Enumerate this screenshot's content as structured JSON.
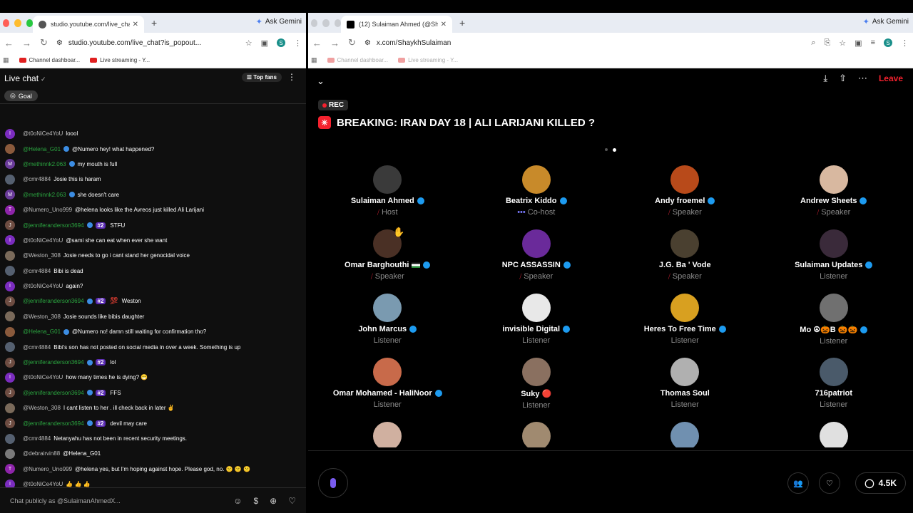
{
  "left_window": {
    "tab_title": "studio.youtube.com/live_chat",
    "url": "studio.youtube.com/live_chat?is_popout...",
    "ask_gemini": "Ask Gemini",
    "profile_initial": "S",
    "bookmarks": [
      "Channel dashboar...",
      "Live streaming - Y..."
    ]
  },
  "chat": {
    "title": "Live chat",
    "top_fans": "Top fans",
    "goal": "Goal",
    "input_placeholder": "Chat publicly as @SulaimanAhmedX...",
    "messages": [
      {
        "initial": "I",
        "color": "#7b2cbf",
        "author": "@t0oNiCe4YoU",
        "green": false,
        "verified": false,
        "rank": "",
        "prefix": "",
        "text": "loool"
      },
      {
        "initial": "",
        "color": "#8a5a3c",
        "author": "@Helena_G01",
        "green": true,
        "verified": true,
        "rank": "",
        "prefix": "",
        "text": "@Numero hey! what happened?"
      },
      {
        "initial": "M",
        "color": "#6a3b9a",
        "author": "@methinnk2.063",
        "green": true,
        "verified": true,
        "rank": "",
        "prefix": "",
        "text": "my mouth is full"
      },
      {
        "initial": "",
        "color": "#556070",
        "author": "@cmr4884",
        "green": false,
        "verified": false,
        "rank": "",
        "prefix": "",
        "text": "Josie this is haram"
      },
      {
        "initial": "M",
        "color": "#6a3b9a",
        "author": "@methinnk2.063",
        "green": true,
        "verified": true,
        "rank": "",
        "prefix": "",
        "text": "she doesn't care"
      },
      {
        "initial": "T",
        "color": "#8e24aa",
        "author": "@Numero_Uno999",
        "green": false,
        "verified": false,
        "rank": "",
        "prefix": "",
        "text": "@helena looks like the Avreos just killed Ali Larijani"
      },
      {
        "initial": "J",
        "color": "#6d4c41",
        "author": "@jenniferanderson3694",
        "green": true,
        "verified": true,
        "rank": "#2",
        "prefix": "",
        "text": "STFU"
      },
      {
        "initial": "I",
        "color": "#7b2cbf",
        "author": "@t0oNiCe4YoU",
        "green": false,
        "verified": false,
        "rank": "",
        "prefix": "",
        "text": "@sami she can eat when ever she want"
      },
      {
        "initial": "",
        "color": "#7a6a5a",
        "author": "@Weston_308",
        "green": false,
        "verified": false,
        "rank": "",
        "prefix": "",
        "text": "Josie needs to go i cant stand her genocidal voice"
      },
      {
        "initial": "",
        "color": "#556070",
        "author": "@cmr4884",
        "green": false,
        "verified": false,
        "rank": "",
        "prefix": "",
        "text": "Bibi is dead"
      },
      {
        "initial": "I",
        "color": "#7b2cbf",
        "author": "@t0oNiCe4YoU",
        "green": false,
        "verified": false,
        "rank": "",
        "prefix": "",
        "text": "again?"
      },
      {
        "initial": "J",
        "color": "#6d4c41",
        "author": "@jenniferanderson3694",
        "green": true,
        "verified": true,
        "rank": "#2",
        "prefix": "💯",
        "text": "Weston"
      },
      {
        "initial": "",
        "color": "#7a6a5a",
        "author": "@Weston_308",
        "green": false,
        "verified": false,
        "rank": "",
        "prefix": "",
        "text": "Josie sounds like bibis daughter"
      },
      {
        "initial": "",
        "color": "#8a5a3c",
        "author": "@Helena_G01",
        "green": true,
        "verified": true,
        "rank": "",
        "prefix": "",
        "text": "@Numero no! damn still waiting for confirmation tho?"
      },
      {
        "initial": "",
        "color": "#556070",
        "author": "@cmr4884",
        "green": false,
        "verified": false,
        "rank": "",
        "prefix": "",
        "text": "Bibi's son has not posted on social media in over a week. Something is up"
      },
      {
        "initial": "J",
        "color": "#6d4c41",
        "author": "@jenniferanderson3694",
        "green": true,
        "verified": true,
        "rank": "#2",
        "prefix": "",
        "text": "lol"
      },
      {
        "initial": "I",
        "color": "#7b2cbf",
        "author": "@t0oNiCe4YoU",
        "green": false,
        "verified": false,
        "rank": "",
        "prefix": "",
        "text": "how many times he is dying? 😁"
      },
      {
        "initial": "J",
        "color": "#6d4c41",
        "author": "@jenniferanderson3694",
        "green": true,
        "verified": true,
        "rank": "#2",
        "prefix": "",
        "text": "FFS"
      },
      {
        "initial": "",
        "color": "#7a6a5a",
        "author": "@Weston_308",
        "green": false,
        "verified": false,
        "rank": "",
        "prefix": "",
        "text": "I cant listen to her . ill check back in later ✌"
      },
      {
        "initial": "J",
        "color": "#6d4c41",
        "author": "@jenniferanderson3694",
        "green": true,
        "verified": true,
        "rank": "#2",
        "prefix": "",
        "text": "devil may care"
      },
      {
        "initial": "",
        "color": "#556070",
        "author": "@cmr4884",
        "green": false,
        "verified": false,
        "rank": "",
        "prefix": "",
        "text": "Netanyahu has not been in recent security meetings."
      },
      {
        "initial": "",
        "color": "#7a7a7a",
        "author": "@debrairvin88",
        "green": false,
        "verified": false,
        "rank": "",
        "prefix": "",
        "text": "@Helena_G01"
      },
      {
        "initial": "T",
        "color": "#8e24aa",
        "author": "@Numero_Uno999",
        "green": false,
        "verified": false,
        "rank": "",
        "prefix": "",
        "text": "@helena yes, but I'm hoping against hope. Please god, no. 🙁 🙁 🙁"
      },
      {
        "initial": "I",
        "color": "#7b2cbf",
        "author": "@t0oNiCe4YoU",
        "green": false,
        "verified": false,
        "rank": "",
        "prefix": "",
        "text": "👍 👍 👍"
      }
    ]
  },
  "right_window": {
    "tab_title": "(12) Sulaiman Ahmed (@Shay",
    "url": "x.com/ShaykhSulaiman",
    "ask_gemini": "Ask Gemini",
    "profile_initial": "S",
    "bookmarks": [
      "Channel dashboar...",
      "Live streaming - Y..."
    ]
  },
  "space": {
    "leave": "Leave",
    "rec": "REC",
    "title": "BREAKING: IRAN DAY 18 | ALI LARIJANI KILLED ?",
    "listener_count": "4.5K",
    "people": [
      {
        "name": "Sulaiman Ahmed",
        "verified": true,
        "role": "Host",
        "role_icon": "mic-off",
        "color": "#3a3a3a",
        "hand": false,
        "flag": false
      },
      {
        "name": "Beatrix Kiddo",
        "verified": true,
        "role": "Co-host",
        "role_icon": "dots",
        "color": "#c88a2a",
        "hand": false,
        "flag": false
      },
      {
        "name": "Andy froemel",
        "verified": true,
        "role": "Speaker",
        "role_icon": "mic-off",
        "color": "#b84a1a",
        "hand": false,
        "flag": false
      },
      {
        "name": "Andrew Sheets",
        "verified": true,
        "role": "Speaker",
        "role_icon": "mic-off",
        "color": "#d8b8a0",
        "hand": false,
        "flag": false
      },
      {
        "name": "Omar Barghouthi",
        "verified": true,
        "role": "Speaker",
        "role_icon": "mic-off",
        "color": "#4a3025",
        "hand": true,
        "flag": true
      },
      {
        "name": "NPC ASSASSIN",
        "verified": true,
        "role": "Speaker",
        "role_icon": "mic-off",
        "color": "#6a2a9a",
        "hand": false,
        "flag": false
      },
      {
        "name": "J.G. Ba ' Vode",
        "verified": false,
        "role": "Speaker",
        "role_icon": "mic-off",
        "color": "#4a4030",
        "hand": false,
        "flag": false
      },
      {
        "name": "Sulaiman Updates",
        "verified": true,
        "role": "Listener",
        "role_icon": "",
        "color": "#3a2a3a",
        "hand": false,
        "flag": false
      },
      {
        "name": "John Marcus",
        "verified": true,
        "role": "Listener",
        "role_icon": "",
        "color": "#7a9ab0",
        "hand": false,
        "flag": false
      },
      {
        "name": "invisible Digital",
        "verified": true,
        "role": "Listener",
        "role_icon": "",
        "color": "#e8e8e8",
        "hand": false,
        "flag": false
      },
      {
        "name": "Heres To Free Time",
        "verified": true,
        "role": "Listener",
        "role_icon": "",
        "color": "#d8a020",
        "hand": false,
        "flag": false
      },
      {
        "name": "Mo ☮🎃B 🎃🎃",
        "verified": true,
        "role": "Listener",
        "role_icon": "",
        "color": "#707070",
        "hand": false,
        "flag": false
      },
      {
        "name": "Omar Mohamed - HaliNoor",
        "verified": true,
        "role": "Listener",
        "role_icon": "",
        "color": "#c86a4a",
        "hand": false,
        "flag": false
      },
      {
        "name": "Suky 🔴",
        "verified": false,
        "role": "Listener",
        "role_icon": "",
        "color": "#8a7060",
        "hand": false,
        "flag": false
      },
      {
        "name": "Thomas Soul",
        "verified": false,
        "role": "Listener",
        "role_icon": "",
        "color": "#b0b0b0",
        "hand": false,
        "flag": false
      },
      {
        "name": "716patriot",
        "verified": false,
        "role": "Listener",
        "role_icon": "",
        "color": "#4a5a6a",
        "hand": false,
        "flag": false
      },
      {
        "name": "",
        "verified": false,
        "role": "",
        "role_icon": "",
        "color": "#d0b0a0",
        "hand": false,
        "flag": false
      },
      {
        "name": "",
        "verified": false,
        "role": "",
        "role_icon": "",
        "color": "#a08a70",
        "hand": false,
        "flag": false
      },
      {
        "name": "",
        "verified": false,
        "role": "",
        "role_icon": "",
        "color": "#7090b0",
        "hand": false,
        "flag": false
      },
      {
        "name": "",
        "verified": false,
        "role": "",
        "role_icon": "",
        "color": "#e0e0e0",
        "hand": false,
        "flag": false
      }
    ]
  }
}
